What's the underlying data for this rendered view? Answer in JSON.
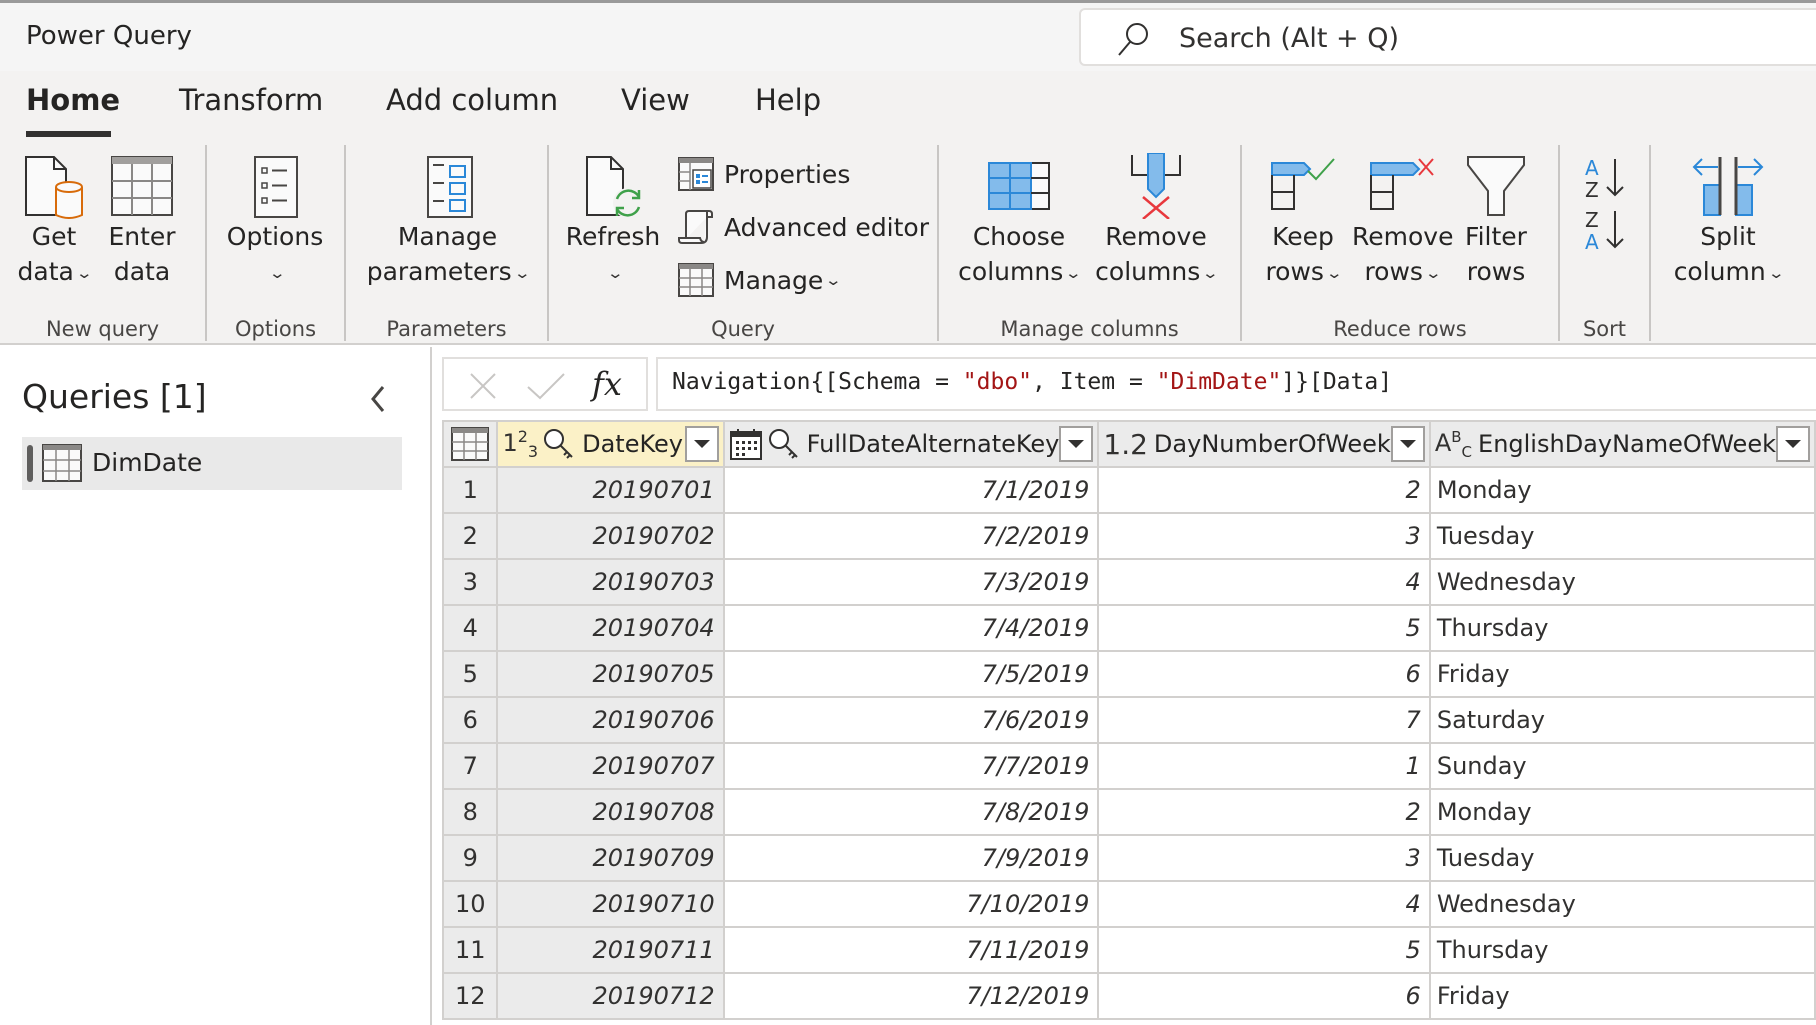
{
  "app": {
    "title": "Power Query",
    "search_placeholder": "Search (Alt + Q)"
  },
  "tabs": [
    {
      "label": "Home",
      "active": true
    },
    {
      "label": "Transform",
      "active": false
    },
    {
      "label": "Add column",
      "active": false
    },
    {
      "label": "View",
      "active": false
    },
    {
      "label": "Help",
      "active": false
    }
  ],
  "ribbon": {
    "groups": {
      "new_query": "New query",
      "options": "Options",
      "parameters": "Parameters",
      "query": "Query",
      "manage_columns": "Manage columns",
      "reduce_rows": "Reduce rows",
      "sort": "Sort"
    },
    "buttons": {
      "get_data": [
        "Get",
        "data"
      ],
      "enter_data": [
        "Enter",
        "data"
      ],
      "options": [
        "Options"
      ],
      "manage_parameters": [
        "Manage",
        "parameters"
      ],
      "refresh": [
        "Refresh"
      ],
      "properties": "Properties",
      "advanced_editor": "Advanced editor",
      "manage": "Manage",
      "choose_columns": [
        "Choose",
        "columns"
      ],
      "remove_columns": [
        "Remove",
        "columns"
      ],
      "keep_rows": [
        "Keep",
        "rows"
      ],
      "remove_rows": [
        "Remove",
        "rows"
      ],
      "filter_rows": [
        "Filter",
        "rows"
      ],
      "sort_asc": "A Z",
      "sort_desc": "Z A",
      "split_column": [
        "Split",
        "column"
      ]
    },
    "colors": {
      "accent_blue": "#2b88d8",
      "light_blue": "#83bbeb",
      "green": "#3fa14a",
      "red": "#e8383d",
      "orange": "#d86b0a"
    }
  },
  "queries": {
    "title": "Queries [1]",
    "items": [
      {
        "label": "DimDate",
        "selected": true
      }
    ]
  },
  "formula_bar": {
    "prefix": "Navigation{[Schema = ",
    "schema": "\"dbo\"",
    "mid": ", Item = ",
    "item": "\"DimDate\"",
    "suffix": "]}[Data]"
  },
  "table": {
    "columns": [
      {
        "type_icon": "1²₃",
        "key": true,
        "name": "DateKey",
        "selected": true
      },
      {
        "type_icon": "calendar",
        "key": true,
        "name": "FullDateAlternateKey",
        "selected": false
      },
      {
        "type_icon": "1.2",
        "key": false,
        "name": "DayNumberOfWeek",
        "selected": false
      },
      {
        "type_icon": "ABC",
        "key": false,
        "name": "EnglishDayNameOfWeek",
        "selected": false
      }
    ],
    "rows": [
      [
        "1",
        "20190701",
        "7/1/2019",
        "2",
        "Monday"
      ],
      [
        "2",
        "20190702",
        "7/2/2019",
        "3",
        "Tuesday"
      ],
      [
        "3",
        "20190703",
        "7/3/2019",
        "4",
        "Wednesday"
      ],
      [
        "4",
        "20190704",
        "7/4/2019",
        "5",
        "Thursday"
      ],
      [
        "5",
        "20190705",
        "7/5/2019",
        "6",
        "Friday"
      ],
      [
        "6",
        "20190706",
        "7/6/2019",
        "7",
        "Saturday"
      ],
      [
        "7",
        "20190707",
        "7/7/2019",
        "1",
        "Sunday"
      ],
      [
        "8",
        "20190708",
        "7/8/2019",
        "2",
        "Monday"
      ],
      [
        "9",
        "20190709",
        "7/9/2019",
        "3",
        "Tuesday"
      ],
      [
        "10",
        "20190710",
        "7/10/2019",
        "4",
        "Wednesday"
      ],
      [
        "11",
        "20190711",
        "7/11/2019",
        "5",
        "Thursday"
      ],
      [
        "12",
        "20190712",
        "7/12/2019",
        "6",
        "Friday"
      ]
    ]
  }
}
